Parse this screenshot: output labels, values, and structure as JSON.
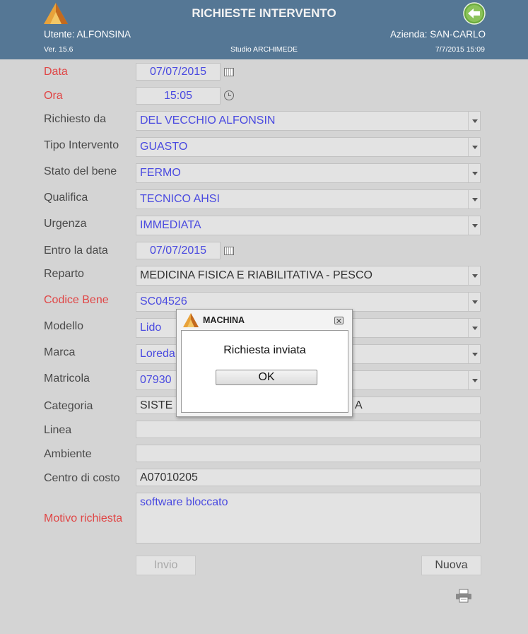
{
  "header": {
    "title": "RICHIESTE INTERVENTO",
    "user": "Utente: ALFONSINA",
    "company": "Azienda: SAN-CARLO",
    "version": "Ver. 15.6",
    "studio": "Studio ARCHIMEDE",
    "datetime": "7/7/2015 15:09"
  },
  "form": {
    "data": {
      "label": "Data",
      "value": "07/07/2015"
    },
    "ora": {
      "label": "Ora",
      "value": "15:05"
    },
    "richiesto_da": {
      "label": "Richiesto da",
      "value": "DEL VECCHIO ALFONSIN"
    },
    "tipo_intervento": {
      "label": "Tipo Intervento",
      "value": "GUASTO"
    },
    "stato_bene": {
      "label": "Stato del bene",
      "value": "FERMO"
    },
    "qualifica": {
      "label": "Qualifica",
      "value": "TECNICO AHSI"
    },
    "urgenza": {
      "label": "Urgenza",
      "value": "IMMEDIATA"
    },
    "entro_data": {
      "label": "Entro la data",
      "value": "07/07/2015"
    },
    "reparto": {
      "label": "Reparto",
      "value": "MEDICINA FISICA E RIABILITATIVA - PESCO"
    },
    "codice_bene": {
      "label": "Codice Bene",
      "value": "SC04526"
    },
    "modello": {
      "label": "Modello",
      "value": "Lido"
    },
    "marca": {
      "label": "Marca",
      "value": "Loreda"
    },
    "matricola": {
      "label": "Matricola",
      "value": "07930"
    },
    "categoria": {
      "label": "Categoria",
      "value_left": "SISTE",
      "value_right": "A"
    },
    "linea": {
      "label": "Linea",
      "value": ""
    },
    "ambiente": {
      "label": "Ambiente",
      "value": ""
    },
    "centro_costo": {
      "label": "Centro di costo",
      "value": "A07010205"
    },
    "motivo": {
      "label": "Motivo richiesta",
      "value": "software bloccato"
    }
  },
  "buttons": {
    "invio": "Invio",
    "nuova": "Nuova"
  },
  "dialog": {
    "title": "MACHINA",
    "message": "Richiesta inviata",
    "ok": "OK"
  },
  "colors": {
    "header_bg": "#557795",
    "required_label": "#e04545",
    "value_text": "#4a4ae0",
    "page_bg": "#d4d4d4"
  },
  "icons": [
    "app-logo-icon",
    "back-arrow-icon",
    "calendar-icon",
    "clock-icon",
    "dropdown-arrow-icon",
    "printer-icon",
    "close-icon"
  ]
}
